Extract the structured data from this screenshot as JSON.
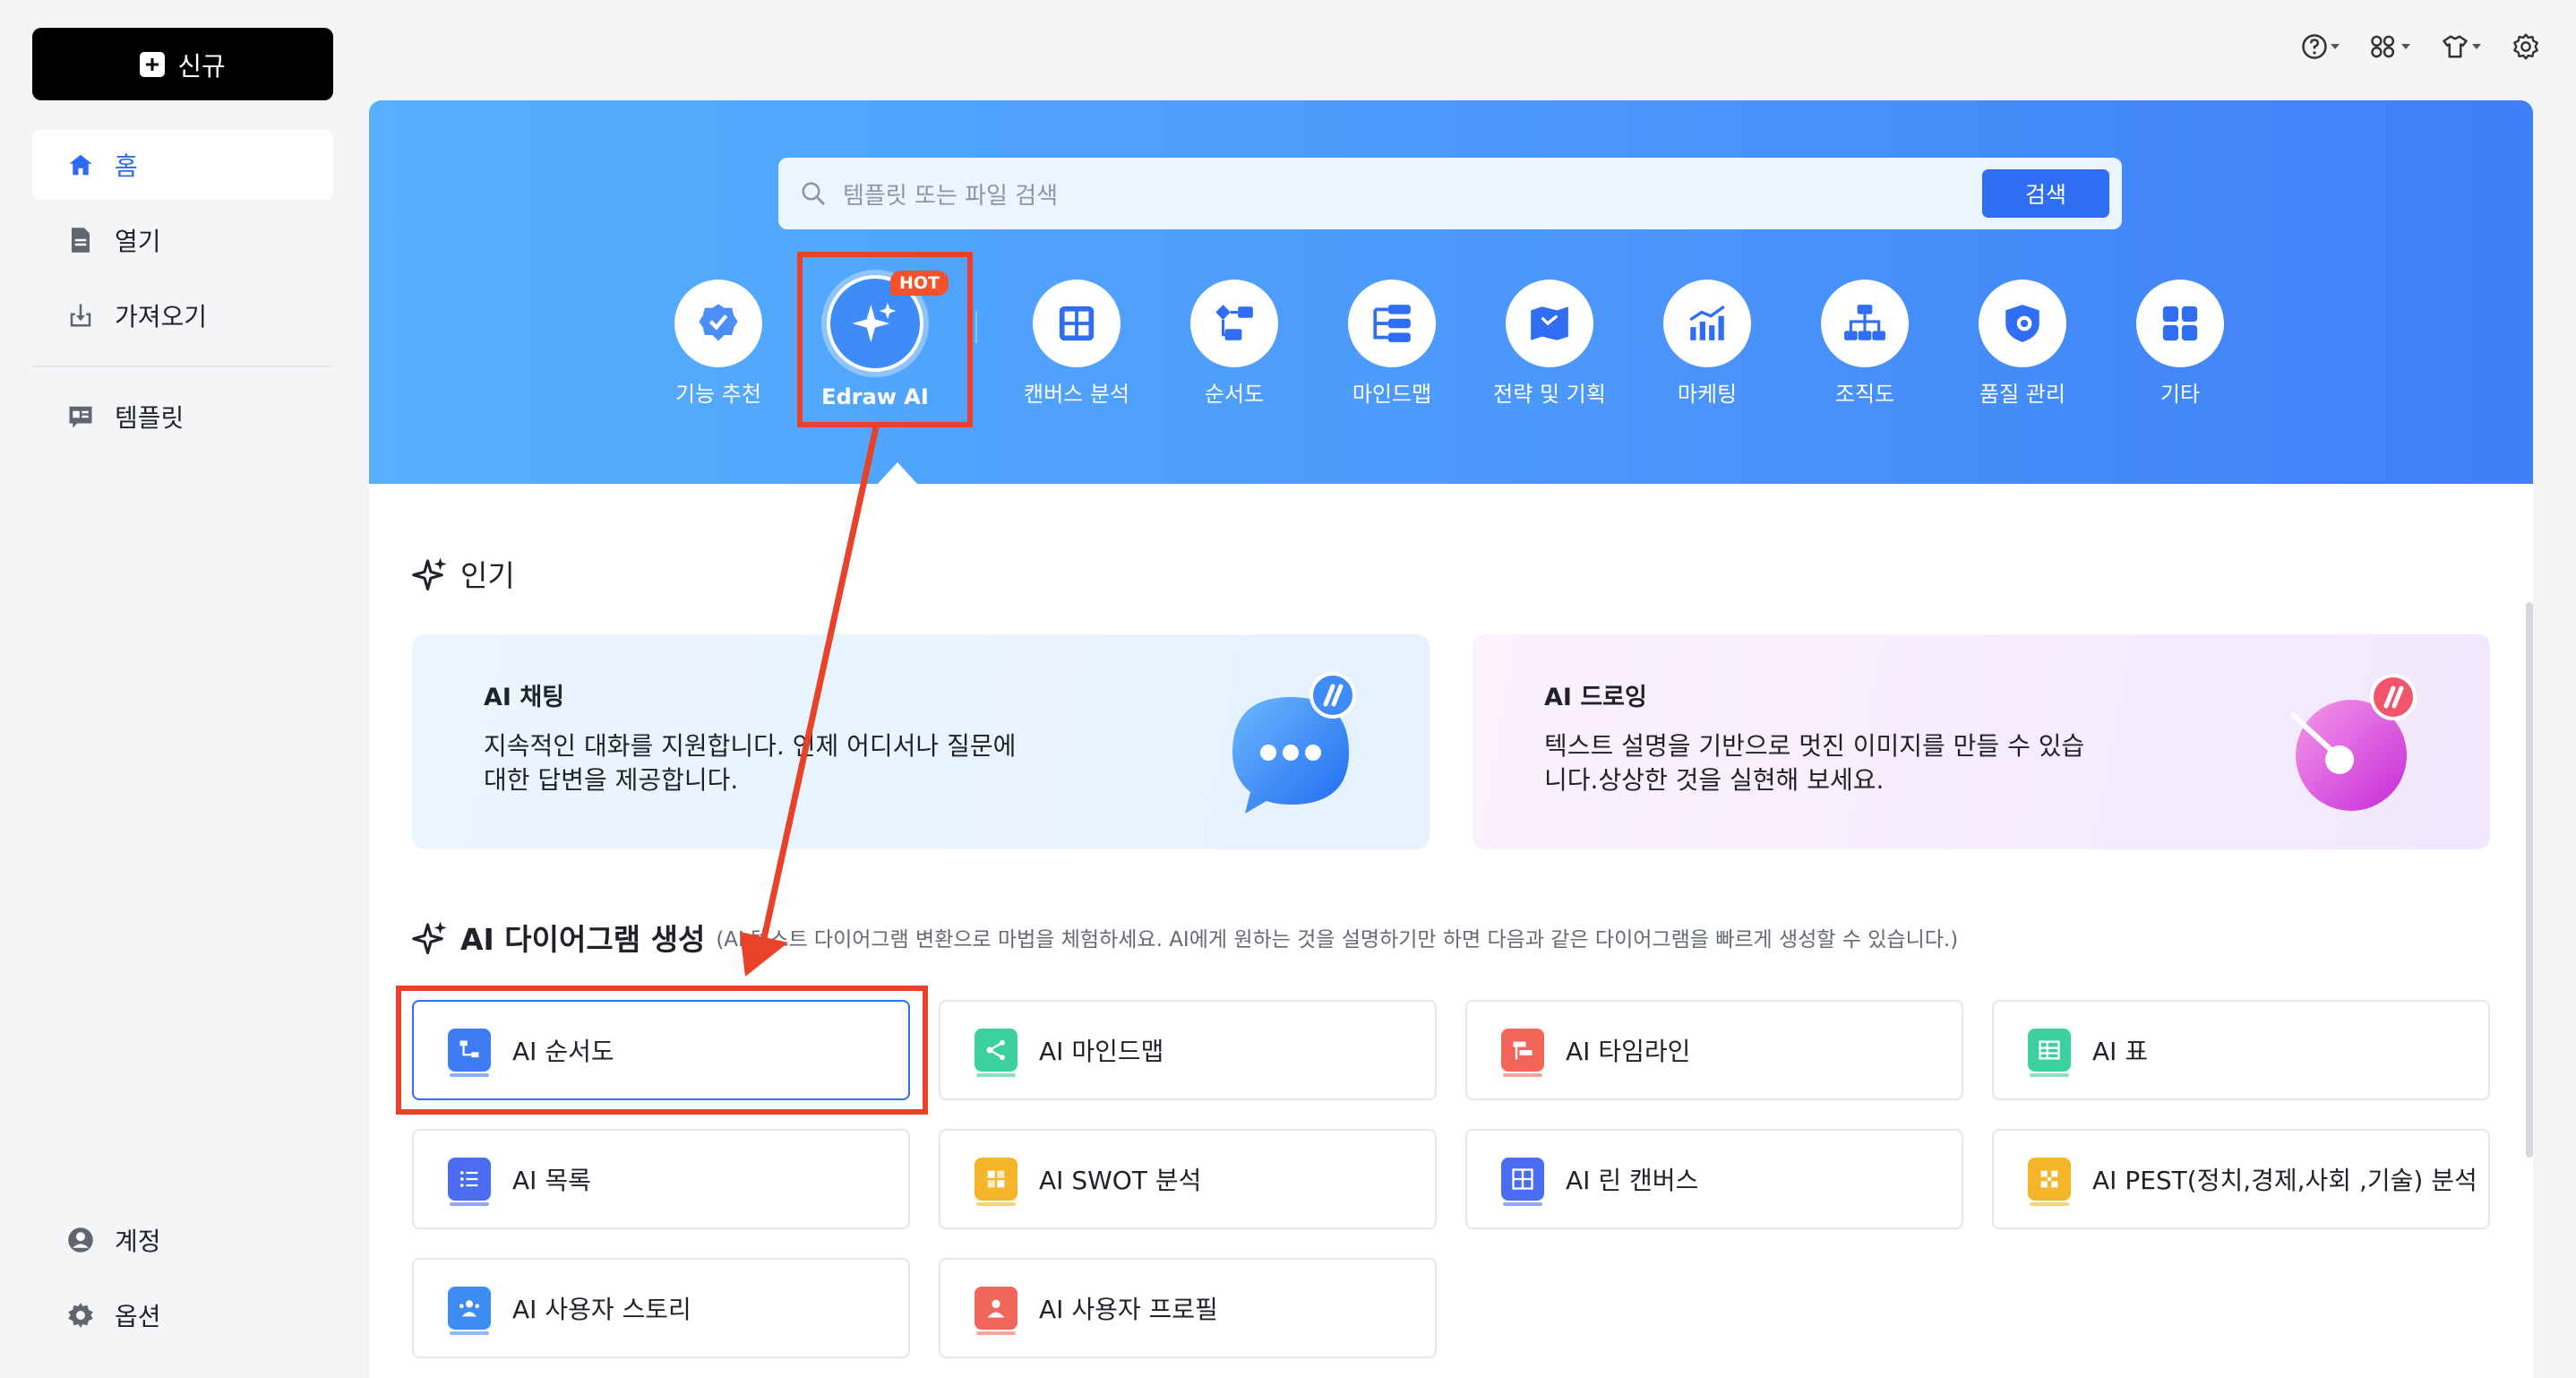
{
  "sidebar": {
    "new_label": "신규",
    "items": [
      {
        "label": "홈",
        "icon": "home-icon"
      },
      {
        "label": "열기",
        "icon": "file-icon"
      },
      {
        "label": "가져오기",
        "icon": "import-icon"
      },
      {
        "label": "템플릿",
        "icon": "template-icon"
      }
    ],
    "bottom": [
      {
        "label": "계정",
        "icon": "account-icon"
      },
      {
        "label": "옵션",
        "icon": "gear-icon"
      }
    ]
  },
  "topbar": {
    "icons": [
      "help-icon",
      "apps-icon",
      "shirt-icon",
      "settings-icon"
    ]
  },
  "search": {
    "placeholder": "템플릿 또는 파일 검색",
    "button": "검색"
  },
  "categories": [
    {
      "label": "기능 추천",
      "icon": "badge-icon"
    },
    {
      "label": "Edraw AI",
      "icon": "sparkle-icon",
      "badge": "HOT"
    },
    {
      "label": "캔버스 분석",
      "icon": "canvas-icon"
    },
    {
      "label": "순서도",
      "icon": "flowchart-icon"
    },
    {
      "label": "마인드맵",
      "icon": "mindmap-icon"
    },
    {
      "label": "전략 및 기획",
      "icon": "map-icon"
    },
    {
      "label": "마케팅",
      "icon": "chart-icon"
    },
    {
      "label": "조직도",
      "icon": "orgchart-icon"
    },
    {
      "label": "품질 관리",
      "icon": "quality-icon"
    },
    {
      "label": "기타",
      "icon": "grid-icon"
    }
  ],
  "popular": {
    "title": "인기",
    "cards": [
      {
        "title": "AI 채팅",
        "desc": "지속적인 대화를 지원합니다. 언제 어디서나 질문에 대한 답변을 제공합니다."
      },
      {
        "title": "AI 드로잉",
        "desc": "텍스트 설명을 기반으로 멋진 이미지를 만들 수 있습니다.상상한 것을 실현해 보세요."
      }
    ]
  },
  "ai_diagram": {
    "title": "AI 다이어그램 생성",
    "subtitle": "(AI 텍스트 다이어그램 변환으로 마법을 체험하세요. AI에게 원하는 것을 설명하기만 하면 다음과 같은 다이어그램을 빠르게 생성할 수 있습니다.)",
    "items": [
      {
        "label": "AI 순서도",
        "color": "#3d7cf2"
      },
      {
        "label": "AI 마인드맵",
        "color": "#3ccfa0"
      },
      {
        "label": "AI 타임라인",
        "color": "#f2655a"
      },
      {
        "label": "AI 표",
        "color": "#3ccfa0"
      },
      {
        "label": "AI 목록",
        "color": "#4a6cf0"
      },
      {
        "label": "AI SWOT 분석",
        "color": "#f5b52a"
      },
      {
        "label": "AI 린 캔버스",
        "color": "#4a6cf0"
      },
      {
        "label": "AI PEST(정치,경제,사회 ,기술) 분석",
        "color": "#f5b52a"
      },
      {
        "label": "AI 사용자 스토리",
        "color": "#3d8cf2"
      },
      {
        "label": "AI 사용자 프로필",
        "color": "#f2655a"
      }
    ]
  },
  "colors": {
    "accent": "#2f6df2",
    "annotation": "#e8432a",
    "hero_start": "#56b0fd",
    "hero_end": "#3f7ff7"
  }
}
